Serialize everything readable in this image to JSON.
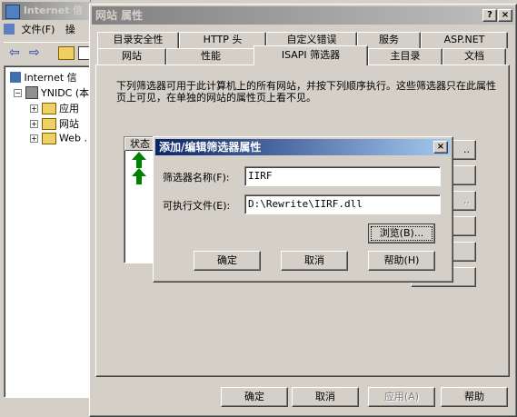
{
  "mmc": {
    "title": "Internet 信",
    "menu": {
      "file": "文件(F)",
      "other": "操"
    },
    "tree": {
      "root": "Internet 信",
      "server": "YNIDC (本",
      "children": [
        "应用",
        "网站",
        "Web ."
      ]
    }
  },
  "props": {
    "title": "网站 属性",
    "help_btn": "?",
    "close_btn": "×",
    "tabs_back": [
      "目录安全性",
      "HTTP 头",
      "自定义错误",
      "服务",
      "ASP.NET"
    ],
    "tabs_front": [
      "网站",
      "性能",
      "ISAPI 筛选器",
      "主目录",
      "文档"
    ],
    "description": "下列筛选器可用于此计算机上的所有网站，并按下列顺序执行。这些筛选器只在此属性页上可见，在单独的网站的属性页上看不见。",
    "list_header_status": "状态",
    "buttons": {
      "ok": "确定",
      "cancel": "取消",
      "apply": "应用(A)",
      "help": "帮助"
    }
  },
  "dialog": {
    "title": "添加/编辑筛选器属性",
    "close_btn": "×",
    "name_label": "筛选器名称(F):",
    "name_value": "IIRF",
    "exe_label": "可执行文件(E):",
    "exe_value": "D:\\Rewrite\\IIRF.dll",
    "browse": "浏览(B)...",
    "ok": "确定",
    "cancel": "取消",
    "help": "帮助(H)"
  },
  "colors": {
    "active_title": "#0a246a",
    "face": "#d4d0c8",
    "arrow": "#008000"
  }
}
